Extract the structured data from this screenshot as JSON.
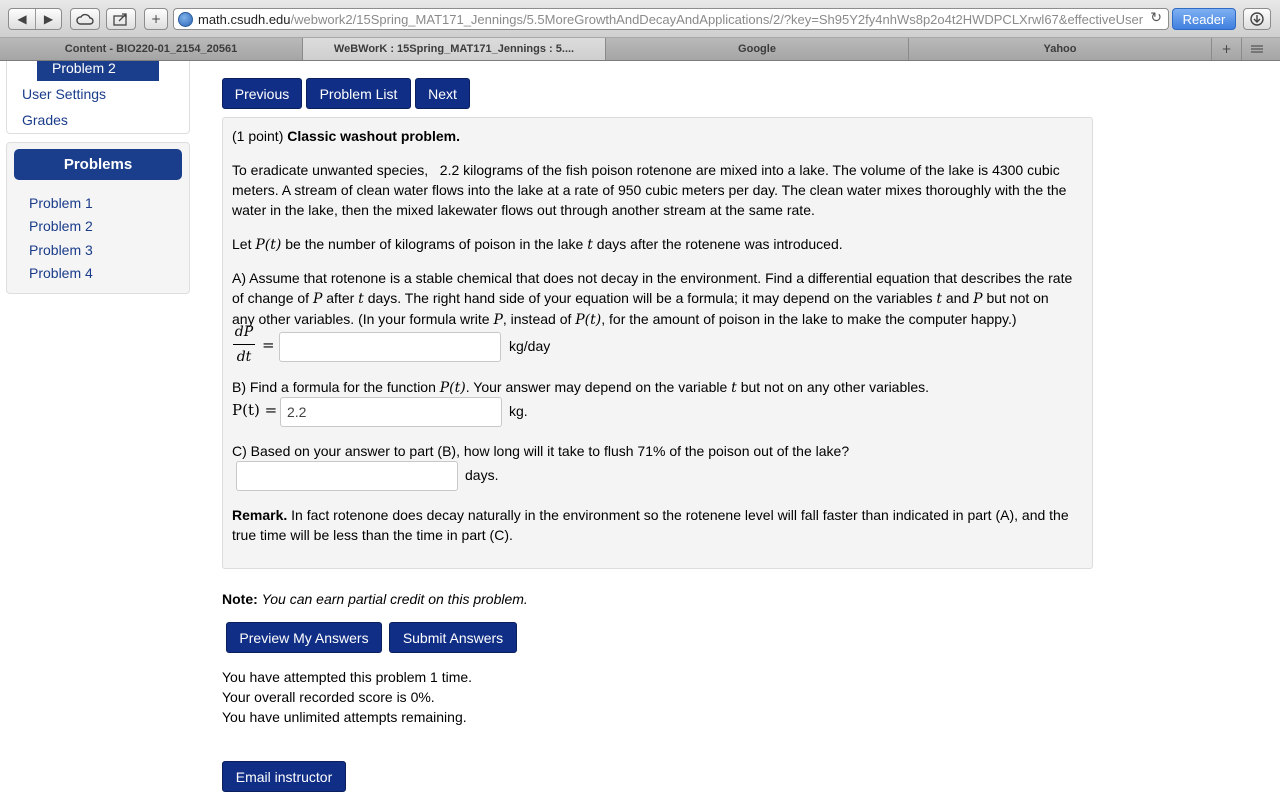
{
  "browser": {
    "url_host": "math.csudh.edu",
    "url_path": "/webwork2/15Spring_MAT171_Jennings/5.5MoreGrowthAndDecayAndApplications/2/?key=Sh95Y2fy4nhWs8p2o4t2HWDPCLXrwl67&effectiveUser",
    "reader_label": "Reader",
    "tabs": [
      {
        "label": "Content - BIO220-01_2154_20561"
      },
      {
        "label": "WeBWorK : 15Spring_MAT171_Jennings : 5...."
      },
      {
        "label": "Google"
      },
      {
        "label": "Yahoo"
      }
    ]
  },
  "sidebar": {
    "current_problem": "Problem 2",
    "links": [
      "User Settings",
      "Grades"
    ],
    "problems_title": "Problems",
    "problems": [
      "Problem 1",
      "Problem 2",
      "Problem 3",
      "Problem 4"
    ]
  },
  "nav_buttons": {
    "previous": "Previous",
    "problem_list": "Problem List",
    "next": "Next"
  },
  "problem": {
    "points": "(1 point)",
    "title": "Classic washout problem.",
    "intro_1": "To eradicate unwanted species,",
    "intro_2": "2.2 kilograms of the fish poison rotenone are mixed into a lake. The volume of the lake is 4300 cubic",
    "intro_3": "meters. A stream of clean water flows into the lake at a rate of 950 cubic meters per day. The clean water mixes thoroughly with the the",
    "intro_4": "water in the lake, then the mixed lakewater flows out through another stream at the same rate.",
    "let_a": "Let",
    "let_b": "be the number of kilograms of poison in the lake",
    "let_c": "days after the rotenene was introduced.",
    "a_1": "A) Assume that rotenone is a stable chemical that does not decay in the environment. Find a differential equation that describes the rate",
    "a_2a": "of change of",
    "a_2b": "after",
    "a_2c": "days. The right hand side of your equation will be a formula; it may depend on the variables",
    "a_2d": "and",
    "a_2e": "but not on",
    "a_3a": "any other variables. (In your formula write",
    "a_3b": ", instead of",
    "a_3c": ", for the amount of poison in the lake to make the computer happy.)",
    "math_P": "P",
    "math_t": "t",
    "math_Pt": "P(t)",
    "math_dP": "dP",
    "math_dt": "dt",
    "math_eq": "=",
    "math_Pt_eq": "P(t) =",
    "a_answer": "",
    "a_unit": "kg/day",
    "b_1a": "B) Find a formula for the function",
    "b_1b": ". Your answer may depend on the variable",
    "b_1c": "but not on any other variables.",
    "b_answer": "2.2",
    "b_unit": "kg.",
    "c_1": "C) Based on your answer to part (B), how long will it take to flush 71% of the poison out of the lake?",
    "c_answer": "",
    "c_unit": "days.",
    "remark_label": "Remark.",
    "remark_1": "In fact rotenone does decay naturally in the environment so the rotenene level will fall faster than indicated in part (A), and the",
    "remark_2": "true time will be less than the time in part (C)."
  },
  "note": {
    "label": "Note:",
    "text": "You can earn partial credit on this problem."
  },
  "actions": {
    "preview": "Preview My Answers",
    "submit": "Submit Answers"
  },
  "status": {
    "attempts": "You have attempted this problem 1 time.",
    "score": "Your overall recorded score is 0%.",
    "remaining": "You have unlimited attempts remaining."
  },
  "email_label": "Email instructor"
}
